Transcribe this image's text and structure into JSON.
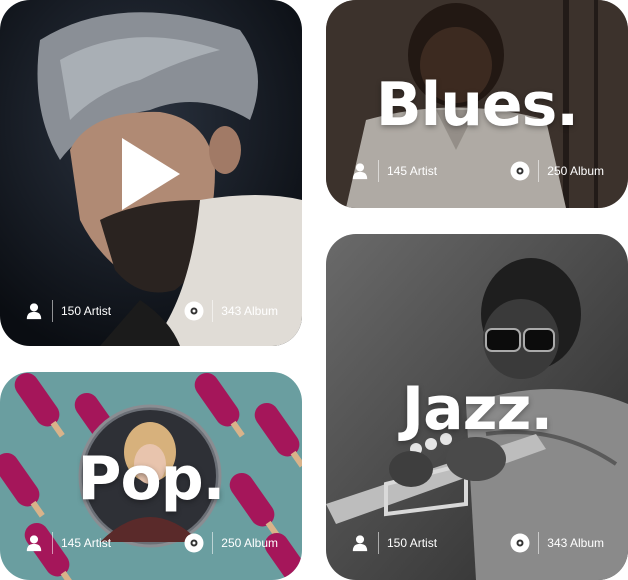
{
  "cards": [
    {
      "id": "featured",
      "title": "",
      "artists": "150 Artist",
      "albums": "343 Album"
    },
    {
      "id": "blues",
      "title": "Blues.",
      "artists": "145 Artist",
      "albums": "250 Album"
    },
    {
      "id": "pop",
      "title": "Pop.",
      "artists": "145 Artist",
      "albums": "250 Album"
    },
    {
      "id": "jazz",
      "title": "Jazz.",
      "artists": "150 Artist",
      "albums": "343 Album"
    }
  ],
  "icons": {
    "artist": "person-icon",
    "album": "disc-icon",
    "play": "play-icon"
  },
  "colors": {
    "pop_background": "#6a9ea0",
    "popsicle": "#a5165a",
    "text": "#ffffff"
  }
}
